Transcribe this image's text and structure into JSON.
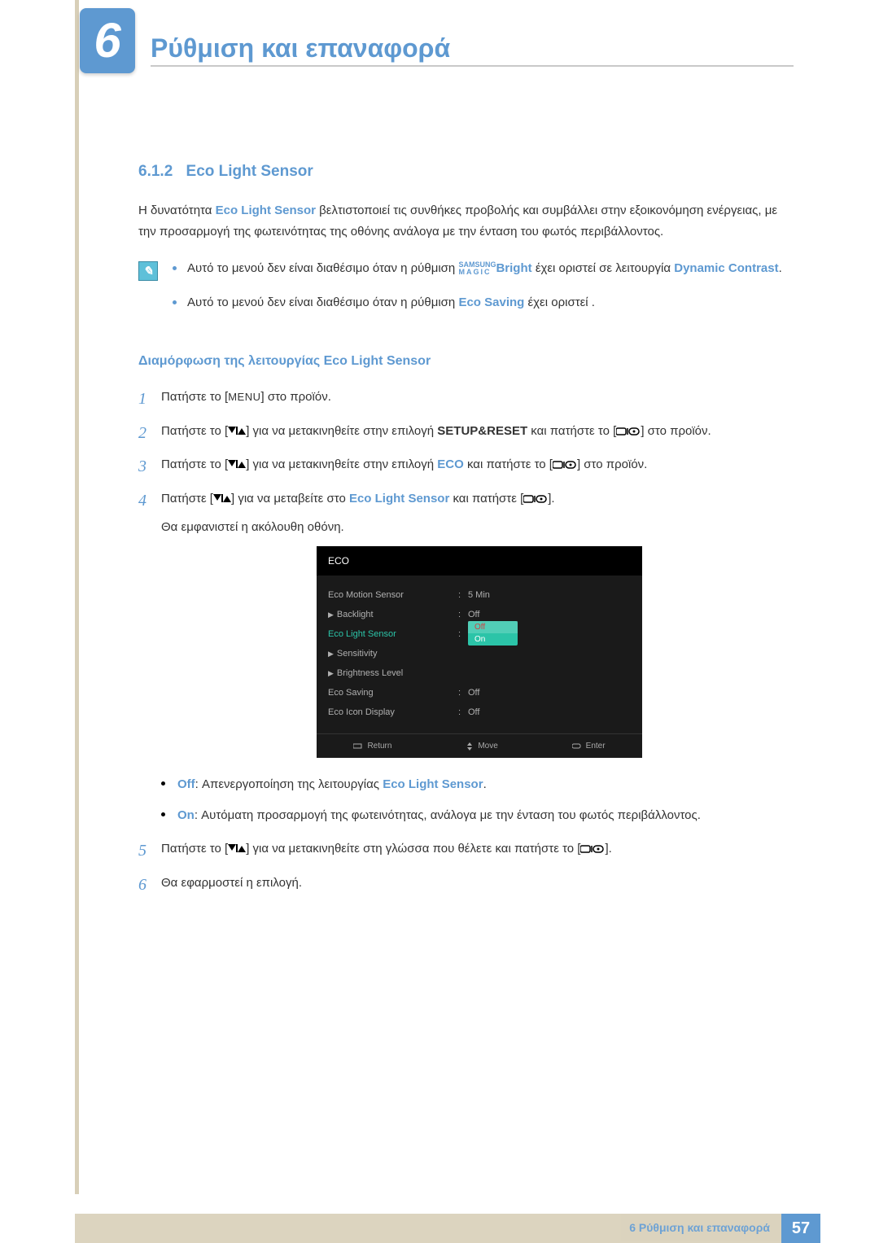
{
  "chapter": {
    "number": "6",
    "title": "Ρύθμιση και επαναφορά"
  },
  "section": {
    "number": "6.1.2",
    "title": "Eco Light Sensor",
    "intro": "Η δυνατότητα Eco Light Sensor βελτιστοποιεί τις συνθήκες προβολής και συμβάλλει στην εξοικονόμηση ενέργειας, με την προσαρμογή της φωτεινότητας της οθόνης ανάλογα με την ένταση του φωτός περιβάλλοντος."
  },
  "notes": {
    "n1a": "Αυτό το μενού δεν είναι διαθέσιμο όταν η ρύθμιση ",
    "n1b": "Bright",
    "n1c": " έχει οριστεί σε λειτουργία ",
    "n1d": "Dynamic Contrast",
    "n1e": ".",
    "magic_top": "SAMSUNG",
    "magic_bot": "MAGIC",
    "n2a": "Αυτό το μενού δεν είναι διαθέσιμο όταν η ρύθμιση ",
    "n2b": "Eco Saving",
    "n2c": " έχει οριστεί ."
  },
  "subsection_title": "Διαμόρφωση της λειτουργίας Eco Light Sensor",
  "steps": {
    "s1a": "Πατήστε το [",
    "s1_menu": "MENU",
    "s1b": "] στο προϊόν.",
    "s2a": "Πατήστε το [",
    "s2b": "] για να μετακινηθείτε στην επιλογή ",
    "s2c": "SETUP&RESET",
    "s2d": " και πατήστε το [",
    "s2e": "] στο προϊόν.",
    "s3a": "Πατήστε το [",
    "s3b": "] για να μετακινηθείτε στην επιλογή ",
    "s3c": "ECO",
    "s3d": " και πατήστε το [",
    "s3e": "] στο προϊόν.",
    "s4a": "Πατήστε [",
    "s4b": "] για να μεταβείτε στο ",
    "s4c": "Eco Light Sensor",
    "s4d": " και πατήστε [",
    "s4e": "].",
    "s4f": "Θα εμφανιστεί η ακόλουθη οθόνη.",
    "off_label": "Off",
    "off_text": ": Απενεργοποίηση της λειτουργίας ",
    "off_feat": "Eco Light Sensor",
    "on_label": "On",
    "on_text": ": Αυτόματη προσαρμογή της φωτεινότητας, ανάλογα με την ένταση του φωτός περιβάλλοντος.",
    "s5a": "Πατήστε το [",
    "s5b": "] για να μετακινηθείτε στη γλώσσα που θέλετε και πατήστε το [",
    "s5c": "].",
    "s6": "Θα εφαρμοστεί η επιλογή."
  },
  "osd": {
    "title": "ECO",
    "rows": [
      {
        "label": "Eco Motion Sensor",
        "arrow": false,
        "value": "5 Min",
        "active": false
      },
      {
        "label": "Backlight",
        "arrow": true,
        "value": "Off",
        "active": false
      },
      {
        "label": "Eco Light Sensor",
        "arrow": false,
        "value": "",
        "active": true
      },
      {
        "label": "Sensitivity",
        "arrow": true,
        "value": "",
        "active": false
      },
      {
        "label": "Brightness Level",
        "arrow": true,
        "value": "",
        "active": false
      },
      {
        "label": "Eco Saving",
        "arrow": false,
        "value": "Off",
        "active": false
      },
      {
        "label": "Eco Icon Display",
        "arrow": false,
        "value": "Off",
        "active": false
      }
    ],
    "options": {
      "off": "Off",
      "on": "On"
    },
    "footer": {
      "return": "Return",
      "move": "Move",
      "enter": "Enter"
    }
  },
  "footer": {
    "chapter_text": "6 Ρύθμιση και επαναφορά",
    "page": "57"
  }
}
